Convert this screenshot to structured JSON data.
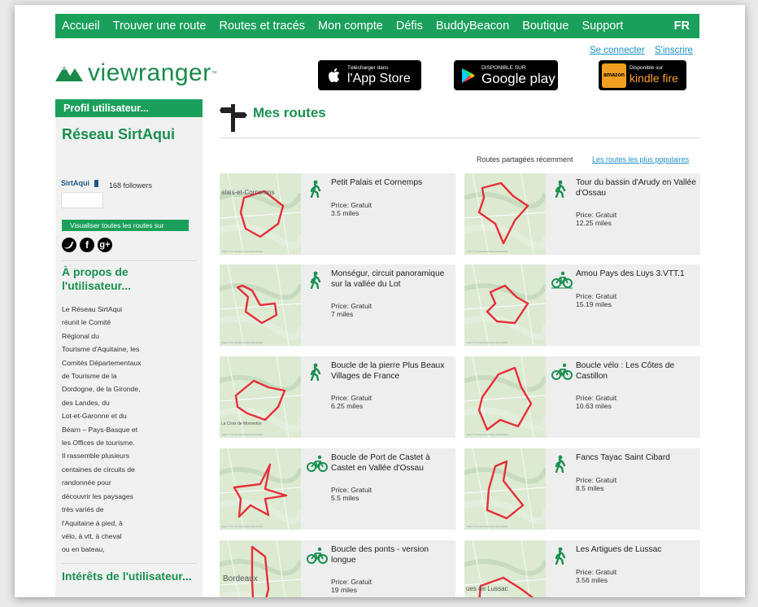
{
  "nav": {
    "items": [
      "Accueil",
      "Trouver une route",
      "Routes et tracés",
      "Mon compte",
      "Défis",
      "BuddyBeacon",
      "Boutique",
      "Support"
    ],
    "lang": "FR"
  },
  "auth": {
    "login": "Se connecter",
    "signup": "S'inscrire"
  },
  "brand": {
    "name": "viewranger",
    "tm": "™"
  },
  "stores": {
    "appstore": {
      "small": "Télécharger dans",
      "big": "l'App Store"
    },
    "googleplay": {
      "small": "DISPONIBLE SUR",
      "big": "Google play"
    },
    "kindle": {
      "small": "Disponible sur",
      "big": "kindle fire",
      "badge": "amazon"
    }
  },
  "sidebar": {
    "header": "Profil utilisateur...",
    "org_name": "Réseau SirtAqui",
    "logo_text": "SirtAqui",
    "followers": "168 followers",
    "view_all": "Visualiser toutes les routes sur",
    "about_title": "À propos de l'utilisateur...",
    "about_text": "Le Réseau SirtAqui\nréunit le Comité\nRégional du\nTourisme d'Aquitaine, les\nComités Départementaux\nde Tourisme de la\nDordogne, de la Gironde,\ndes Landes, du\nLot-et-Garonne et du\nBéarn – Pays-Basque et\nles Offices de tourisme.\nIl rassemble plusieurs\ncentaines de circuits de\nrandonnée pour\ndécouvrir les paysages\ntrès variés de\nl'Aquitaine à pied, à\nvélo, à vtt, à cheval\nou en bateau,",
    "interests_title": "Intérêts de l'utilisateur..."
  },
  "main": {
    "title": "Mes routes",
    "shared_label": "Routes partagées récemment",
    "popular_link": "Les routes les plus populaires"
  },
  "colors": {
    "brand_green": "#1aa05a",
    "link_blue": "#1a8fcc",
    "route_red": "#e8303a"
  },
  "routes": [
    {
      "name": "Petit Palais et Cornemps",
      "price": "Price: Gratuit",
      "distance": "3.5 miles",
      "activity": "walking-icon",
      "map_label": "alais-et-Cornemps"
    },
    {
      "name": "Tour du bassin d'Arudy en Vallée d'Ossau",
      "price": "Price: Gratuit",
      "distance": "12.25 miles",
      "activity": "walking-icon",
      "map_label": ""
    },
    {
      "name": "Monségur, circuit panoramique sur la vallée du Lot",
      "price": "Price: Gratuit",
      "distance": "7 miles",
      "activity": "walking-icon",
      "map_label": ""
    },
    {
      "name": "Amou Pays des Luys 3.VTT.1",
      "price": "Price: Gratuit",
      "distance": "15.19 miles",
      "activity": "mountain-bike-icon",
      "map_label": ""
    },
    {
      "name": "Boucle de la pierre Plus Beaux Villages de France",
      "price": "Price: Gratuit",
      "distance": "6.25 miles",
      "activity": "walking-icon",
      "map_label": "La Croix de Monredon"
    },
    {
      "name": "Boucle vélo : Les Côtes de Castillon",
      "price": "Price: Gratuit",
      "distance": "10.63 miles",
      "activity": "bicycle-icon",
      "map_label": ""
    },
    {
      "name": "Boucle de Port de Castet à Castet en Vallée d'Ossau",
      "price": "Price: Gratuit",
      "distance": "5.5 miles",
      "activity": "bicycle-icon",
      "map_label": ""
    },
    {
      "name": "Fancs Tayac Saint Cibard",
      "price": "Price: Gratuit",
      "distance": "8.5 miles",
      "activity": "walking-icon",
      "map_label": ""
    },
    {
      "name": "Boucle des ponts - version longue",
      "price": "Price: Gratuit",
      "distance": "19 miles",
      "activity": "bicycle-icon",
      "map_label": "Bordeaux"
    },
    {
      "name": "Les Artigues de Lussac",
      "price": "Price: Gratuit",
      "distance": "3.56 miles",
      "activity": "walking-icon",
      "map_label": "ues de Lussac"
    }
  ]
}
